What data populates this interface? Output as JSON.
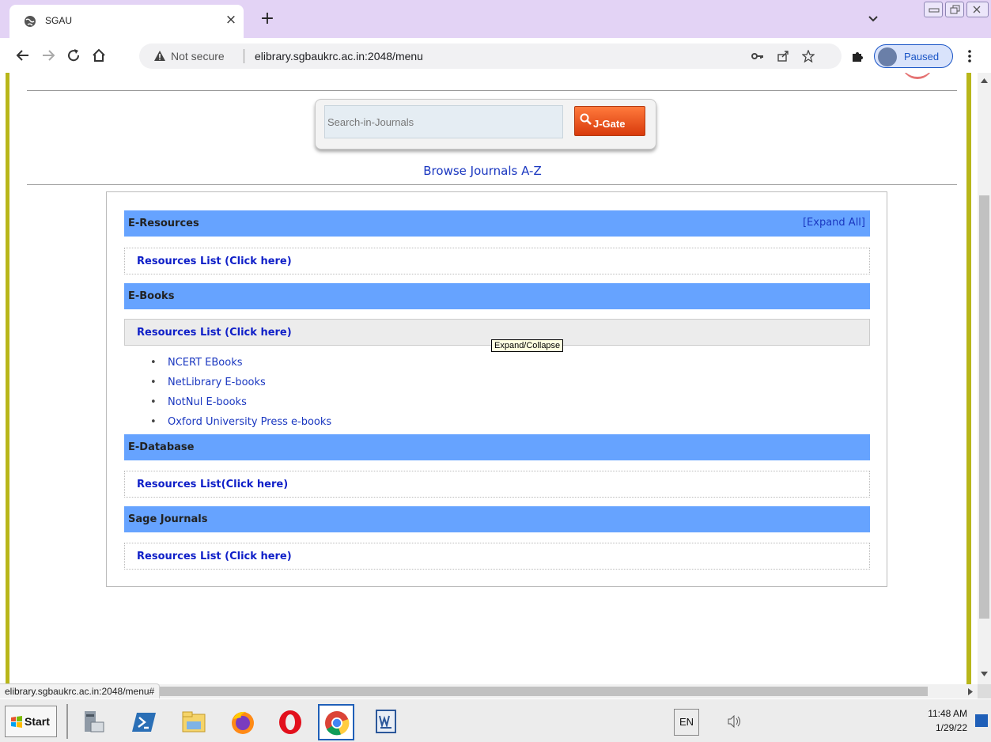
{
  "browser": {
    "tab_title": "SGAU",
    "tab_close": "×",
    "new_tab": "+",
    "security_label": "Not secure",
    "url": "elibrary.sgbaukrc.ac.in:2048/menu",
    "profile_label": "Paused"
  },
  "page": {
    "search_placeholder": "Search-in-Journals",
    "search_button_label": "J-Gate",
    "browse_link": "Browse Journals A-Z",
    "expand_all": "[Expand All]",
    "sections": [
      {
        "title": "E-Resources",
        "link": "Resources List (Click here)"
      },
      {
        "title": "E-Books",
        "link": "Resources List (Click here)",
        "items": [
          "NCERT EBooks",
          "NetLibrary E-books",
          "NotNul E-books",
          "Oxford University Press e-books"
        ]
      },
      {
        "title": "E-Database",
        "link": "Resources List(Click here)"
      },
      {
        "title": "Sage Journals",
        "link": "Resources List (Click here)"
      }
    ],
    "tooltip": "Expand/Collapse"
  },
  "status_bar_url": "elibrary.sgbaukrc.ac.in:2048/menu#",
  "taskbar": {
    "start_label": "Start",
    "language": "EN",
    "time": "11:48 AM",
    "date": "1/29/22"
  },
  "colors": {
    "section_header": "#66a3ff",
    "link": "#1a37c0",
    "side_bar": "#b8b61a",
    "tab_strip": "#e3d3f5"
  }
}
